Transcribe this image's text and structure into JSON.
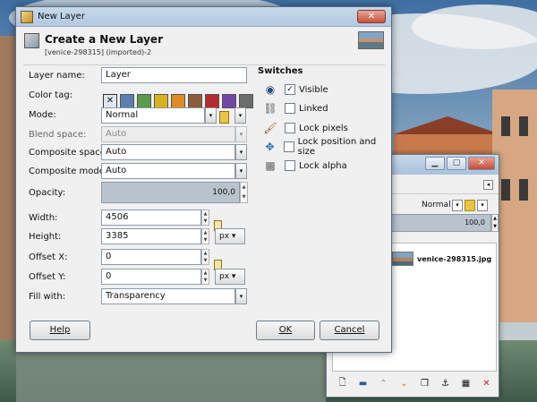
{
  "colors": {
    "title_bar": "#c7d8ea",
    "opacity_fill": "#b9c3cd",
    "dialog_bg": "#f0f0f0"
  },
  "dialog": {
    "window_title": "New Layer",
    "header_title": "Create a New Layer",
    "header_subtitle": "[venice-298315] (imported)-2",
    "close_glyph": "✕",
    "fields": {
      "layer_name_label": "Layer name:",
      "layer_name_value": "Layer",
      "color_tag_label": "Color tag:",
      "color_tag_none_glyph": "✕",
      "color_tags": [
        "#5a7fb0",
        "#5c9a4c",
        "#d7b21f",
        "#e08a26",
        "#8b5d3d",
        "#b42d2d",
        "#7047a5",
        "#6c6c6c"
      ],
      "mode_label": "Mode:",
      "mode_value": "Normal",
      "blend_space_label": "Blend space:",
      "blend_space_value": "Auto",
      "composite_space_label": "Composite space:",
      "composite_space_value": "Auto",
      "composite_mode_label": "Composite mode:",
      "composite_mode_value": "Auto",
      "opacity_label": "Opacity:",
      "opacity_value": "100,0",
      "opacity_level": 1.0,
      "width_label": "Width:",
      "width_value": "4506",
      "height_label": "Height:",
      "height_value": "3385",
      "size_unit": "px ▾",
      "offset_x_label": "Offset X:",
      "offset_x_value": "0",
      "offset_y_label": "Offset Y:",
      "offset_y_value": "0",
      "offset_unit": "px ▾",
      "fill_with_label": "Fill with:",
      "fill_with_value": "Transparency"
    },
    "switches": {
      "title": "Switches",
      "items": [
        {
          "label": "Visible",
          "checked": true,
          "check_glyph": "✓"
        },
        {
          "label": "Linked",
          "checked": false,
          "check_glyph": ""
        },
        {
          "label": "Lock pixels",
          "checked": false,
          "check_glyph": ""
        },
        {
          "label": "Lock position and size",
          "checked": false,
          "check_glyph": ""
        },
        {
          "label": "Lock alpha",
          "checked": false,
          "check_glyph": ""
        }
      ]
    },
    "buttons": {
      "help": "Help",
      "ok": "OK",
      "cancel": "Cancel"
    }
  },
  "layers_window": {
    "mode_value": "Normal",
    "opacity_value": "100,0",
    "layer_name": "venice-298315.jpg",
    "min_glyph": "▁",
    "max_glyph": "▢",
    "close_glyph": "✕"
  }
}
